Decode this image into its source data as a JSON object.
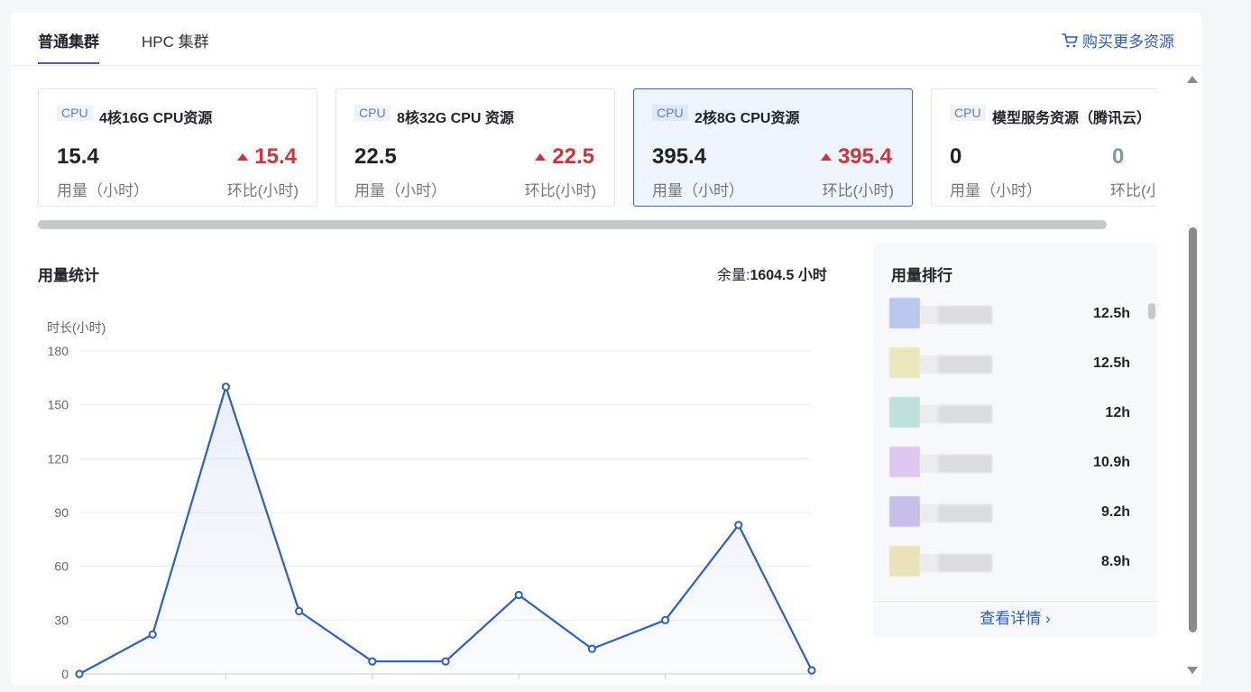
{
  "tabs": [
    {
      "label": "普通集群",
      "active": true
    },
    {
      "label": "HPC 集群",
      "active": false
    }
  ],
  "buy_link": {
    "label": "购买更多资源",
    "icon": "cart-icon"
  },
  "cards": [
    {
      "tag": "CPU",
      "title": "4核16G CPU资源",
      "value": "15.4",
      "value_label": "用量（小时）",
      "ratio": "15.4",
      "ratio_label": "环比(小时)",
      "selected": false,
      "trend": "up"
    },
    {
      "tag": "CPU",
      "title": "8核32G CPU 资源",
      "value": "22.5",
      "value_label": "用量（小时）",
      "ratio": "22.5",
      "ratio_label": "环比(小时)",
      "selected": false,
      "trend": "up"
    },
    {
      "tag": "CPU",
      "title": "2核8G CPU资源",
      "value": "395.4",
      "value_label": "用量（小时）",
      "ratio": "395.4",
      "ratio_label": "环比(小时)",
      "selected": true,
      "trend": "up"
    },
    {
      "tag": "CPU",
      "title": "模型服务资源（腾讯云）",
      "value": "0",
      "value_label": "用量（小时）",
      "ratio": "0",
      "ratio_label": "环比(小时)",
      "selected": false,
      "trend": "flat"
    }
  ],
  "usage": {
    "title": "用量统计",
    "remain_label": "余量:",
    "remain_value": "1604.5 小时"
  },
  "chart_data": {
    "type": "line",
    "ylabel": "时长(小时)",
    "ylim": [
      0,
      180
    ],
    "yticks": [
      0,
      30,
      60,
      90,
      120,
      150,
      180
    ],
    "x": [
      0,
      1,
      2,
      3,
      4,
      5,
      6,
      7,
      8,
      9,
      10
    ],
    "series": [
      {
        "values": [
          0,
          22,
          160,
          35,
          7,
          7,
          44,
          14,
          30,
          83,
          2
        ]
      }
    ],
    "grid": true,
    "line_color": "#2e5fc1"
  },
  "ranking": {
    "title": "用量排行",
    "items": [
      {
        "value": "12.5h",
        "color": "#9fb2e8"
      },
      {
        "value": "12.5h",
        "color": "#e8dfa4"
      },
      {
        "value": "12h",
        "color": "#a8d8cf"
      },
      {
        "value": "10.9h",
        "color": "#d3b3ea"
      },
      {
        "value": "9.2h",
        "color": "#b3a8e4"
      },
      {
        "value": "8.9h",
        "color": "#e8d9a0"
      }
    ],
    "footer": "查看详情 ›"
  },
  "colors": {
    "accent": "#2b5bc2",
    "tab_indicator": "#5b4fd6",
    "up": "#d0343b",
    "neutral": "#8a94a6"
  }
}
